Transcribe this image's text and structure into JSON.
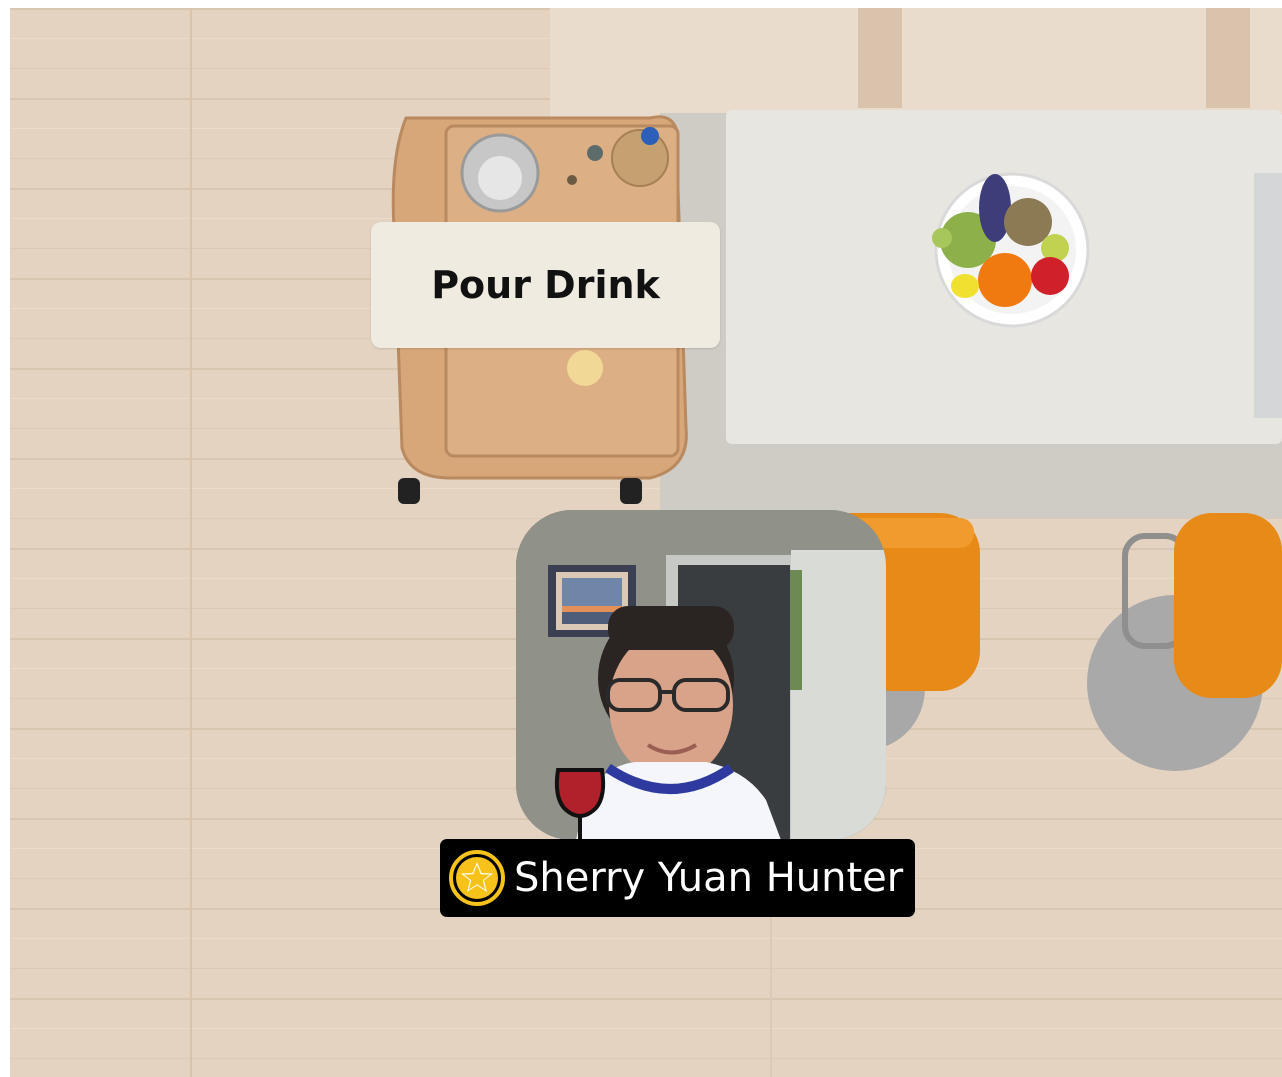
{
  "scene": {
    "floor_color": "#e4d3c0",
    "table_color": "#e8e6e1",
    "chair_color": "#e88a17",
    "cart_color": "#d8a879"
  },
  "pour_drink_button": {
    "label": "Pour Drink"
  },
  "participant": {
    "name": "Sherry Yuan Hunter",
    "badge_icon": "star-icon",
    "badge_color": "#f7c31a",
    "drink_icon": "wine-glass-icon",
    "drink_color": "#b0212b"
  }
}
